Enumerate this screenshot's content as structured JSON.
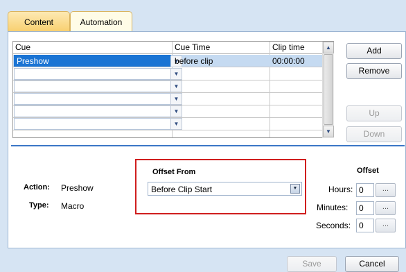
{
  "tabs": [
    {
      "label": "Content"
    },
    {
      "label": "Automation"
    }
  ],
  "grid": {
    "columns": [
      "Cue",
      "Cue Time",
      "Clip time"
    ],
    "rows": [
      {
        "cue": "Preshow",
        "cue_time": "before clip",
        "clip_time": "00:00:00"
      },
      {
        "cue": "",
        "cue_time": "",
        "clip_time": ""
      },
      {
        "cue": "",
        "cue_time": "",
        "clip_time": ""
      },
      {
        "cue": "",
        "cue_time": "",
        "clip_time": ""
      },
      {
        "cue": "",
        "cue_time": "",
        "clip_time": ""
      },
      {
        "cue": "",
        "cue_time": "",
        "clip_time": ""
      }
    ]
  },
  "side_buttons": {
    "add": "Add",
    "remove": "Remove",
    "up": "Up",
    "down": "Down"
  },
  "details": {
    "action_label": "Action:",
    "action_value": "Preshow",
    "type_label": "Type:",
    "type_value": "Macro"
  },
  "offset_from": {
    "title": "Offset From",
    "selected": "Before Clip Start"
  },
  "offset": {
    "title": "Offset",
    "hours_label": "Hours:",
    "hours": "0",
    "minutes_label": "Minutes:",
    "minutes": "0",
    "seconds_label": "Seconds:",
    "seconds": "0",
    "browse_label": "..."
  },
  "footer": {
    "save": "Save",
    "cancel": "Cancel"
  },
  "colors": {
    "highlight_box": "#d01e1e",
    "selection": "#1a74d4",
    "separator": "#3b77c6"
  }
}
